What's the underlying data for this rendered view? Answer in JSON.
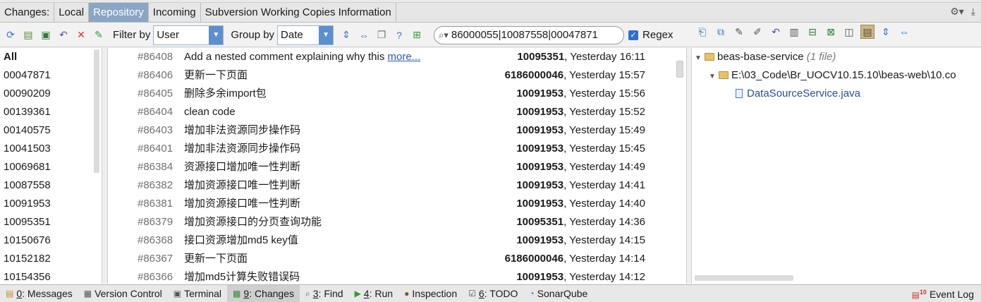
{
  "tabs": {
    "caption": "Changes:",
    "items": [
      "Local",
      "Repository",
      "Incoming",
      "Subversion Working Copies Information"
    ],
    "active": "Repository"
  },
  "toolbar": {
    "filter_label": "Filter by",
    "filter_value": "User",
    "group_label": "Group by",
    "group_value": "Date",
    "search_value": "86000055|10087558|00047871",
    "regex_label": "Regex",
    "regex_checked": true
  },
  "users": [
    "All",
    "00047871",
    "00090209",
    "00139361",
    "00140575",
    "10041503",
    "10069681",
    "10087558",
    "10091953",
    "10095351",
    "10150676",
    "10152182",
    "10154356"
  ],
  "commits": [
    {
      "num": "#86408",
      "msg": "Add a nested comment explaining why this ",
      "more": "more...",
      "author": "10095351",
      "time": ", Yesterday 16:11"
    },
    {
      "num": "#86406",
      "msg": "更新一下页面",
      "more": "",
      "author": "6186000046",
      "time": ", Yesterday 15:57"
    },
    {
      "num": "#86405",
      "msg": "删除多余import包",
      "more": "",
      "author": "10091953",
      "time": ", Yesterday 15:56"
    },
    {
      "num": "#86404",
      "msg": "clean code",
      "more": "",
      "author": "10091953",
      "time": ", Yesterday 15:52"
    },
    {
      "num": "#86403",
      "msg": "增加非法资源同步操作码",
      "more": "",
      "author": "10091953",
      "time": ", Yesterday 15:49"
    },
    {
      "num": "#86401",
      "msg": "增加非法资源同步操作码",
      "more": "",
      "author": "10091953",
      "time": ", Yesterday 15:45"
    },
    {
      "num": "#86384",
      "msg": "资源接口增加唯一性判断",
      "more": "",
      "author": "10091953",
      "time": ", Yesterday 14:49"
    },
    {
      "num": "#86382",
      "msg": "增加资源接口唯一性判断",
      "more": "",
      "author": "10091953",
      "time": ", Yesterday 14:41"
    },
    {
      "num": "#86381",
      "msg": "增加资源接口唯一性判断",
      "more": "",
      "author": "10091953",
      "time": ", Yesterday 14:40"
    },
    {
      "num": "#86379",
      "msg": "增加资源接口的分页查询功能",
      "more": "",
      "author": "10095351",
      "time": ", Yesterday 14:36"
    },
    {
      "num": "#86368",
      "msg": "接口资源增加md5 key值",
      "more": "",
      "author": "10091953",
      "time": ", Yesterday 14:15"
    },
    {
      "num": "#86367",
      "msg": "更新一下页面",
      "more": "",
      "author": "6186000046",
      "time": ", Yesterday 14:14"
    },
    {
      "num": "#86366",
      "msg": "增加md5计算失败错误码",
      "more": "",
      "author": "10091953",
      "time": ", Yesterday 14:12"
    }
  ],
  "tree": {
    "root_label": "beas-base-service",
    "root_count": "(1 file)",
    "path_label": "E:\\03_Code\\Br_UOCV10.15.10\\beas-web\\10.co",
    "file_label": "DataSourceService.java"
  },
  "statusbar": {
    "items": [
      {
        "key": "0",
        "label": ": Messages",
        "icon": "messages-icon"
      },
      {
        "key": "",
        "label": "Version Control",
        "icon": "version-control-icon"
      },
      {
        "key": "",
        "label": "Terminal",
        "icon": "terminal-icon"
      },
      {
        "key": "9",
        "label": ": Changes",
        "icon": "changes-icon"
      },
      {
        "key": "3",
        "label": ": Find",
        "icon": "find-icon"
      },
      {
        "key": "4",
        "label": ": Run",
        "icon": "run-icon"
      },
      {
        "key": "",
        "label": "Inspection",
        "icon": "inspection-icon"
      },
      {
        "key": "6",
        "label": ": TODO",
        "icon": "todo-icon"
      },
      {
        "key": "",
        "label": "SonarQube",
        "icon": "sonarqube-icon"
      }
    ],
    "event_log_badge": "10",
    "event_log_label": "Event Log"
  },
  "colors": {
    "accent_tab": "#8aa6c4",
    "combo_arrow": "#5b8fcf",
    "link": "#2d5ba8"
  }
}
